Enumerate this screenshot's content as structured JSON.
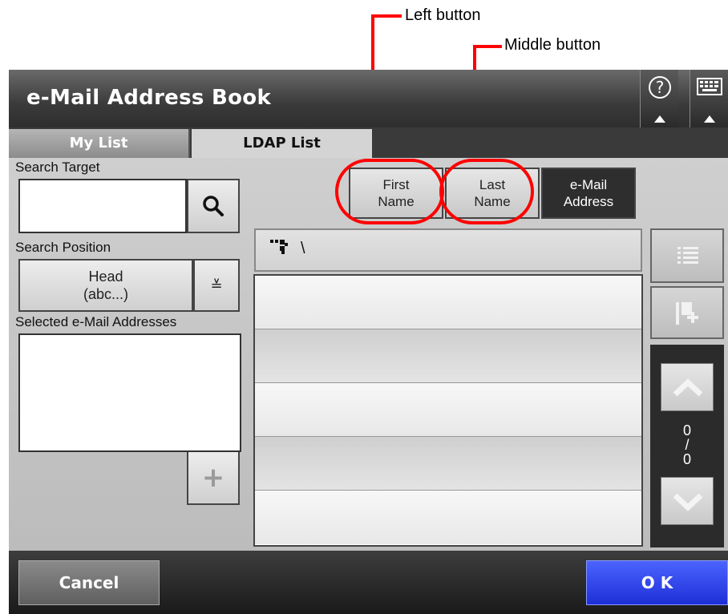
{
  "annotations": {
    "left_button": "Left button",
    "middle_button": "Middle button"
  },
  "titlebar": {
    "title": "e-Mail Address Book",
    "help_icon": "?",
    "keyboard_icon": "keyboard-icon"
  },
  "tabs": [
    {
      "label": "My List",
      "active": false
    },
    {
      "label": "LDAP List",
      "active": true
    }
  ],
  "search": {
    "target_label": "Search Target",
    "target_value": "",
    "search_icon": "magnifier-icon",
    "position_label": "Search Position",
    "position_value_line1": "Head",
    "position_value_line2": "(abc...)",
    "selected_label": "Selected e-Mail Addresses",
    "add_icon": "+"
  },
  "sort_buttons": [
    {
      "line1": "First",
      "line2": "Name",
      "active": false
    },
    {
      "line1": "Last",
      "line2": "Name",
      "active": false
    },
    {
      "line1": "e-Mail",
      "line2": "Address",
      "active": true
    }
  ],
  "path": {
    "text": "\\",
    "icon": "tree-icon"
  },
  "list": {
    "rows": [
      "",
      "",
      "",
      "",
      ""
    ]
  },
  "pager": {
    "current": "0",
    "separator": "/",
    "total": "0"
  },
  "footer": {
    "cancel_label": "Cancel",
    "ok_label": "O K"
  },
  "colors": {
    "annotation": "#ff0000",
    "ok_button": "#2a3cf0",
    "titlebar": "#3a3a3a"
  }
}
